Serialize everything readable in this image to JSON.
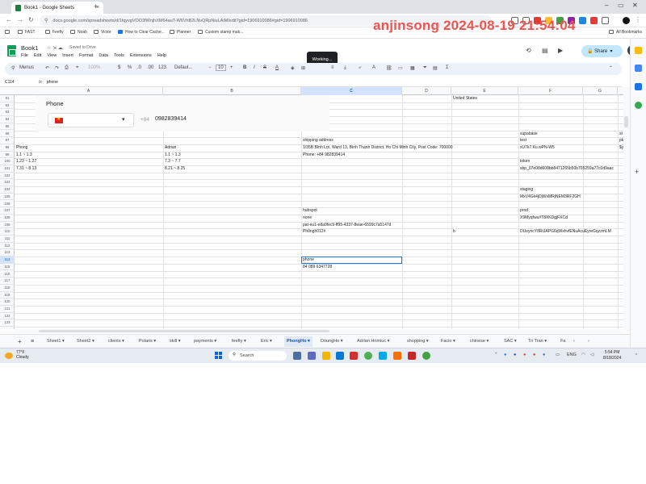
{
  "browser": {
    "tab_title": "Book1 - Google Sheets",
    "url": "docs.google.com/spreadsheets/d/1tqyvgVOO3fWnjhXM64auT-W6VhB2LNvQRpNiuLAiM/edit?gid=1906910086#gid=1906910086",
    "bookmarks": [
      "FAST",
      "Feefly",
      "Noah",
      "Victor",
      "How to Clear Cache...",
      "Planner",
      "Custom stamp mak..."
    ],
    "all_bookmarks": "All Bookmarks"
  },
  "watermark": "anjinsong 2024-08-19 21:54:04",
  "sheets": {
    "doc_title": "Book1",
    "saved_status": "Saved to Drive",
    "menu": [
      "File",
      "Edit",
      "View",
      "Insert",
      "Format",
      "Data",
      "Tools",
      "Extensions",
      "Help"
    ],
    "working_tooltip": "Working...",
    "share_label": "Share",
    "toolbar": {
      "menus_label": "Menus",
      "zoom": "100%",
      "currency": "$",
      "percent": "%",
      "dec_dec": ".0",
      "inc_dec": ".00",
      "number_format": "123",
      "font": "Defaul...",
      "font_size": "10"
    },
    "name_box": "C114",
    "formula_value": "phone"
  },
  "grid": {
    "columns": [
      "A",
      "B",
      "C",
      "D",
      "E",
      "F",
      "G"
    ],
    "selected_column": "C",
    "rows": [
      "91",
      "92",
      "93",
      "94",
      "95",
      "96",
      "97",
      "98",
      "99",
      "100",
      "101",
      "102",
      "103",
      "104",
      "105",
      "106",
      "107",
      "108",
      "109",
      "110",
      "111",
      "112",
      "113",
      "114",
      "115",
      "116",
      "117",
      "118",
      "119",
      "120",
      "121",
      "122",
      "123"
    ],
    "selected_row": "114",
    "phone_widget": {
      "label": "Phone",
      "country_code": "+84",
      "number": "0982839414"
    },
    "cells": [
      {
        "r": 0,
        "c": "E",
        "v": "United States"
      },
      {
        "r": 5,
        "c": "F",
        "v": "supabase"
      },
      {
        "r": 5,
        "c": "H",
        "v": "st"
      },
      {
        "r": 6,
        "c": "C",
        "v": "shipping address"
      },
      {
        "r": 6,
        "c": "F",
        "v": "test"
      },
      {
        "r": 6,
        "c": "H",
        "v": "pk"
      },
      {
        "r": 7,
        "c": "A",
        "v": "Phong"
      },
      {
        "r": 7,
        "c": "B",
        "v": "Adrian"
      },
      {
        "r": 7,
        "c": "C",
        "v": "1/35B Bình Lợi, Ward 13, Bình Thạnh District, Ho Chi Minh City, Post Code: 700000"
      },
      {
        "r": 7,
        "c": "F",
        "v": "xU7k7.Ku.wPN-W5"
      },
      {
        "r": 7,
        "c": "H",
        "v": "$y"
      },
      {
        "r": 8,
        "c": "A",
        "v": "1.1 ~ 1.3"
      },
      {
        "r": 8,
        "c": "B",
        "v": "1.1 ~ 1.3"
      },
      {
        "r": 8,
        "c": "C",
        "v": "Phone: +84 982839414"
      },
      {
        "r": 9,
        "c": "A",
        "v": "1.23 ~ 1.27"
      },
      {
        "r": 9,
        "c": "B",
        "v": "7.3 ~ 7.7"
      },
      {
        "r": 9,
        "c": "F",
        "v": "token"
      },
      {
        "r": 10,
        "c": "A",
        "v": "7.31 ~ 8.13"
      },
      {
        "r": 10,
        "c": "B",
        "v": "8.21 ~ 8.25"
      },
      {
        "r": 10,
        "c": "F",
        "v": "sbp_07e08d600bb8471265b50b705259a77c0d9aac"
      },
      {
        "r": 13,
        "c": "F",
        "v": "staging"
      },
      {
        "r": 14,
        "c": "F",
        "v": "MxV4Gk4jDjWsMRjNEM3RF2GH"
      },
      {
        "r": 16,
        "c": "C",
        "v": "hubspot"
      },
      {
        "r": 16,
        "c": "F",
        "v": "prod"
      },
      {
        "r": 17,
        "c": "C",
        "v": "none"
      },
      {
        "r": 17,
        "c": "F",
        "v": "X9Myqfwu#T8XKDgjFXCd"
      },
      {
        "r": 18,
        "c": "C",
        "v": "pat-eu1-eda9fec9-ff95-4337-8eae-6599c7a5147d"
      },
      {
        "r": 19,
        "c": "C",
        "v": "Ph0ngh012#"
      },
      {
        "r": 19,
        "c": "E",
        "v": "b"
      },
      {
        "r": 19,
        "c": "F",
        "v": "DUeyncY8RtJAPG6qWxhvfENuAcuEyreGqzzmLM"
      },
      {
        "r": 24,
        "c": "C",
        "v": "84 089 6347728"
      }
    ],
    "selected_cell_value": "phone"
  },
  "sheet_tabs": [
    "Sheet1",
    "Sheet2",
    "clients",
    "Polaris",
    "skill",
    "payments",
    "feefty",
    "Eric",
    "PhongHo",
    "DoungHo",
    "Adrian Hrimiuc",
    "shopping",
    "Facio",
    "chinese",
    "SAC",
    "Tri Tran",
    "Fa"
  ],
  "active_tab": "PhongHo",
  "taskbar": {
    "weather_temp": "77°F",
    "weather_desc": "Cloudy",
    "search_placeholder": "Search",
    "lang": "ENG",
    "time": "5:54 PM",
    "date": "8/18/2024"
  }
}
